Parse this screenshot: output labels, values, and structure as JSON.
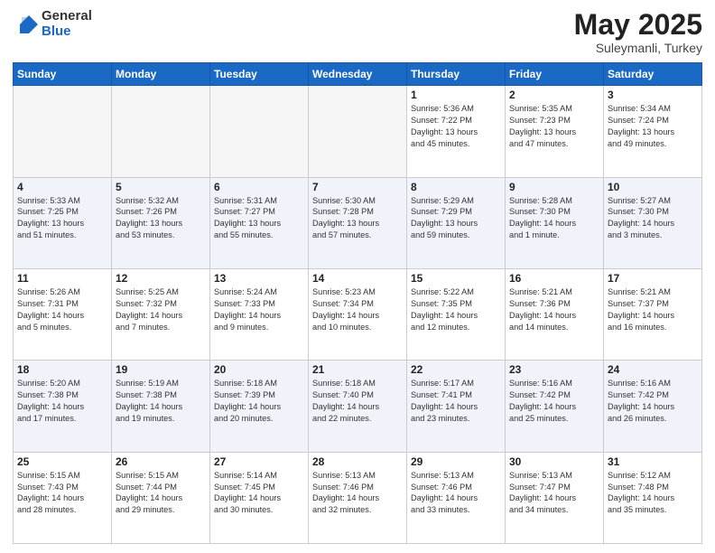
{
  "header": {
    "logo_general": "General",
    "logo_blue": "Blue",
    "month_title": "May 2025",
    "subtitle": "Suleymanli, Turkey"
  },
  "weekdays": [
    "Sunday",
    "Monday",
    "Tuesday",
    "Wednesday",
    "Thursday",
    "Friday",
    "Saturday"
  ],
  "weeks": [
    [
      {
        "day": "",
        "info": "",
        "empty": true
      },
      {
        "day": "",
        "info": "",
        "empty": true
      },
      {
        "day": "",
        "info": "",
        "empty": true
      },
      {
        "day": "",
        "info": "",
        "empty": true
      },
      {
        "day": "1",
        "info": "Sunrise: 5:36 AM\nSunset: 7:22 PM\nDaylight: 13 hours\nand 45 minutes."
      },
      {
        "day": "2",
        "info": "Sunrise: 5:35 AM\nSunset: 7:23 PM\nDaylight: 13 hours\nand 47 minutes."
      },
      {
        "day": "3",
        "info": "Sunrise: 5:34 AM\nSunset: 7:24 PM\nDaylight: 13 hours\nand 49 minutes."
      }
    ],
    [
      {
        "day": "4",
        "info": "Sunrise: 5:33 AM\nSunset: 7:25 PM\nDaylight: 13 hours\nand 51 minutes."
      },
      {
        "day": "5",
        "info": "Sunrise: 5:32 AM\nSunset: 7:26 PM\nDaylight: 13 hours\nand 53 minutes."
      },
      {
        "day": "6",
        "info": "Sunrise: 5:31 AM\nSunset: 7:27 PM\nDaylight: 13 hours\nand 55 minutes."
      },
      {
        "day": "7",
        "info": "Sunrise: 5:30 AM\nSunset: 7:28 PM\nDaylight: 13 hours\nand 57 minutes."
      },
      {
        "day": "8",
        "info": "Sunrise: 5:29 AM\nSunset: 7:29 PM\nDaylight: 13 hours\nand 59 minutes."
      },
      {
        "day": "9",
        "info": "Sunrise: 5:28 AM\nSunset: 7:30 PM\nDaylight: 14 hours\nand 1 minute."
      },
      {
        "day": "10",
        "info": "Sunrise: 5:27 AM\nSunset: 7:30 PM\nDaylight: 14 hours\nand 3 minutes."
      }
    ],
    [
      {
        "day": "11",
        "info": "Sunrise: 5:26 AM\nSunset: 7:31 PM\nDaylight: 14 hours\nand 5 minutes."
      },
      {
        "day": "12",
        "info": "Sunrise: 5:25 AM\nSunset: 7:32 PM\nDaylight: 14 hours\nand 7 minutes."
      },
      {
        "day": "13",
        "info": "Sunrise: 5:24 AM\nSunset: 7:33 PM\nDaylight: 14 hours\nand 9 minutes."
      },
      {
        "day": "14",
        "info": "Sunrise: 5:23 AM\nSunset: 7:34 PM\nDaylight: 14 hours\nand 10 minutes."
      },
      {
        "day": "15",
        "info": "Sunrise: 5:22 AM\nSunset: 7:35 PM\nDaylight: 14 hours\nand 12 minutes."
      },
      {
        "day": "16",
        "info": "Sunrise: 5:21 AM\nSunset: 7:36 PM\nDaylight: 14 hours\nand 14 minutes."
      },
      {
        "day": "17",
        "info": "Sunrise: 5:21 AM\nSunset: 7:37 PM\nDaylight: 14 hours\nand 16 minutes."
      }
    ],
    [
      {
        "day": "18",
        "info": "Sunrise: 5:20 AM\nSunset: 7:38 PM\nDaylight: 14 hours\nand 17 minutes."
      },
      {
        "day": "19",
        "info": "Sunrise: 5:19 AM\nSunset: 7:38 PM\nDaylight: 14 hours\nand 19 minutes."
      },
      {
        "day": "20",
        "info": "Sunrise: 5:18 AM\nSunset: 7:39 PM\nDaylight: 14 hours\nand 20 minutes."
      },
      {
        "day": "21",
        "info": "Sunrise: 5:18 AM\nSunset: 7:40 PM\nDaylight: 14 hours\nand 22 minutes."
      },
      {
        "day": "22",
        "info": "Sunrise: 5:17 AM\nSunset: 7:41 PM\nDaylight: 14 hours\nand 23 minutes."
      },
      {
        "day": "23",
        "info": "Sunrise: 5:16 AM\nSunset: 7:42 PM\nDaylight: 14 hours\nand 25 minutes."
      },
      {
        "day": "24",
        "info": "Sunrise: 5:16 AM\nSunset: 7:42 PM\nDaylight: 14 hours\nand 26 minutes."
      }
    ],
    [
      {
        "day": "25",
        "info": "Sunrise: 5:15 AM\nSunset: 7:43 PM\nDaylight: 14 hours\nand 28 minutes."
      },
      {
        "day": "26",
        "info": "Sunrise: 5:15 AM\nSunset: 7:44 PM\nDaylight: 14 hours\nand 29 minutes."
      },
      {
        "day": "27",
        "info": "Sunrise: 5:14 AM\nSunset: 7:45 PM\nDaylight: 14 hours\nand 30 minutes."
      },
      {
        "day": "28",
        "info": "Sunrise: 5:13 AM\nSunset: 7:46 PM\nDaylight: 14 hours\nand 32 minutes."
      },
      {
        "day": "29",
        "info": "Sunrise: 5:13 AM\nSunset: 7:46 PM\nDaylight: 14 hours\nand 33 minutes."
      },
      {
        "day": "30",
        "info": "Sunrise: 5:13 AM\nSunset: 7:47 PM\nDaylight: 14 hours\nand 34 minutes."
      },
      {
        "day": "31",
        "info": "Sunrise: 5:12 AM\nSunset: 7:48 PM\nDaylight: 14 hours\nand 35 minutes."
      }
    ]
  ]
}
